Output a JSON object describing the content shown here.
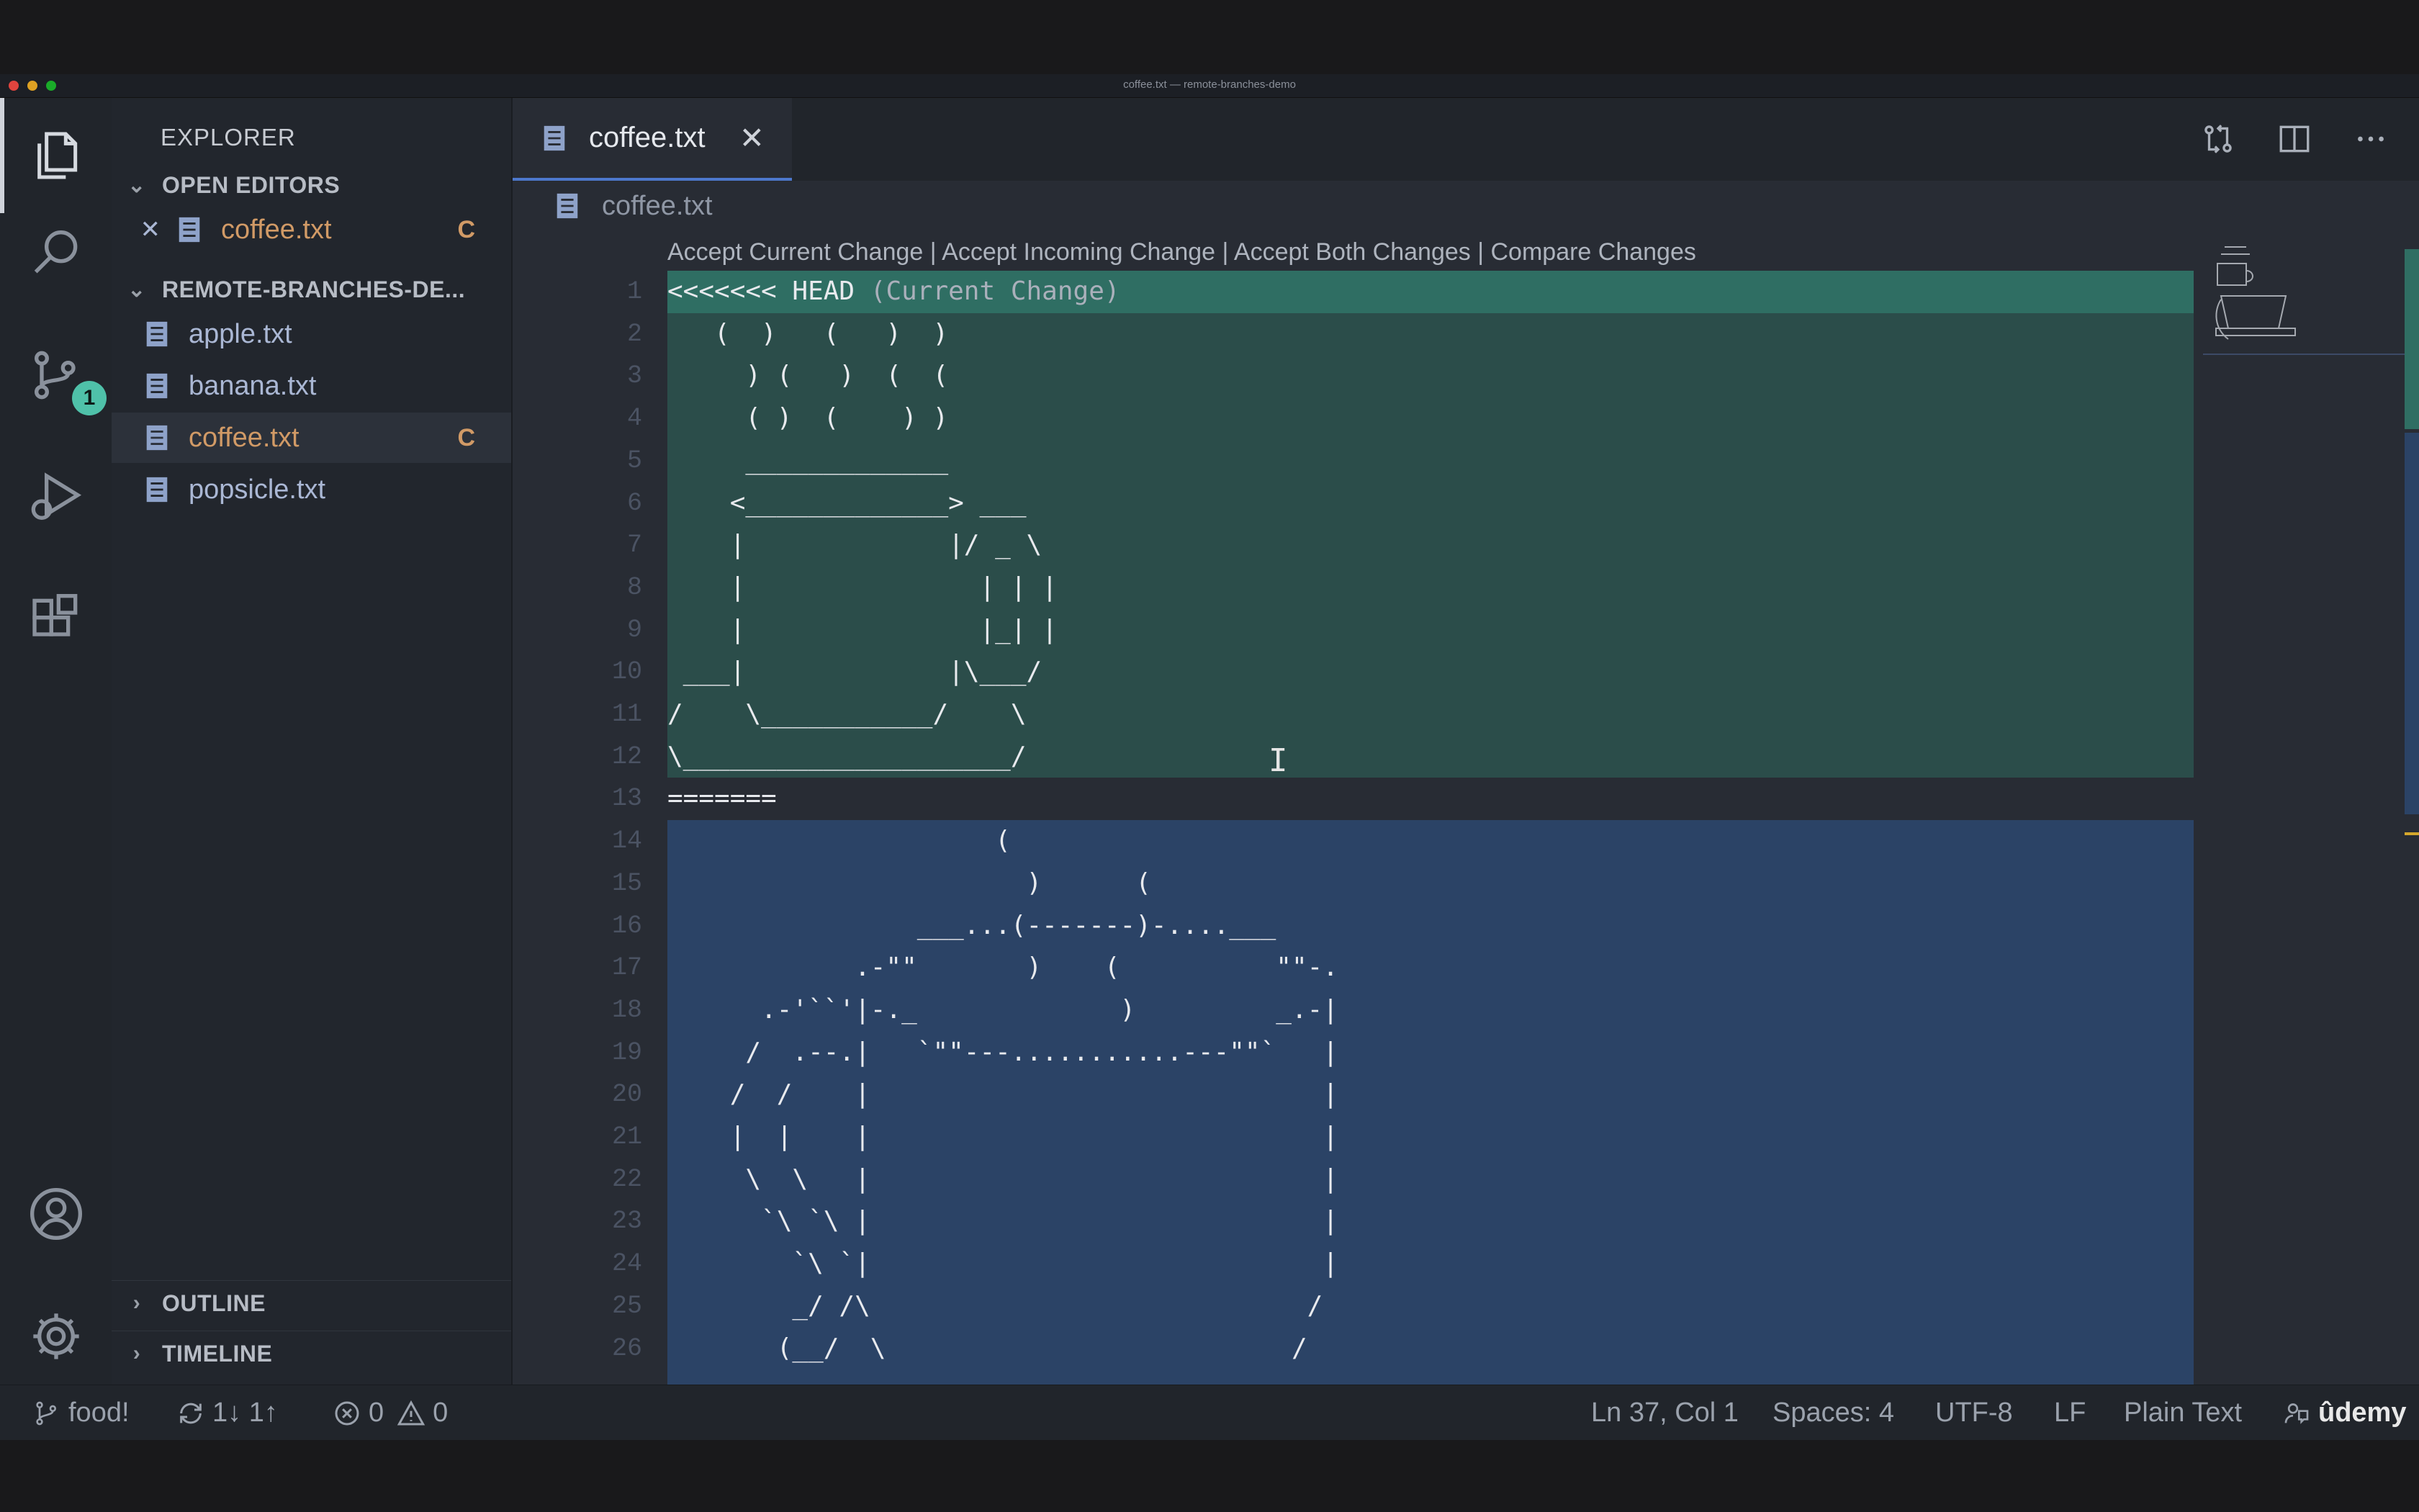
{
  "window": {
    "title": "coffee.txt — remote-branches-demo"
  },
  "activity_bar": {
    "items": [
      {
        "name": "explorer-icon",
        "active": true
      },
      {
        "name": "search-icon"
      },
      {
        "name": "source-control-icon",
        "badge": "1"
      },
      {
        "name": "run-debug-icon"
      },
      {
        "name": "extensions-icon"
      }
    ],
    "bottom": [
      {
        "name": "accounts-icon"
      },
      {
        "name": "settings-gear-icon"
      }
    ]
  },
  "sidebar": {
    "title": "EXPLORER",
    "open_editors": {
      "label": "OPEN EDITORS",
      "items": [
        {
          "close": "✕",
          "name": "coffee.txt",
          "status": "C"
        }
      ]
    },
    "folder": {
      "label": "REMOTE-BRANCHES-DE...",
      "files": [
        {
          "name": "apple.txt",
          "status": ""
        },
        {
          "name": "banana.txt",
          "status": ""
        },
        {
          "name": "coffee.txt",
          "status": "C"
        },
        {
          "name": "popsicle.txt",
          "status": ""
        }
      ]
    },
    "outline_label": "OUTLINE",
    "timeline_label": "TIMELINE"
  },
  "editor": {
    "tab": {
      "label": "coffee.txt",
      "close": "✕"
    },
    "breadcrumb": "coffee.txt",
    "codelens": "Accept Current Change | Accept Incoming Change | Accept Both Changes | Compare Changes",
    "head_marker": "<<<<<<< HEAD",
    "head_label": " (Current Change)",
    "lines": [
      "",
      "   (  )   (   )  )",
      "     ) (   )  (  (",
      "     ( )  (    ) )",
      "     _____________",
      "    <_____________> ___",
      "    |             |/ _ \\",
      "    |               | | |",
      "    |               |_| |",
      " ___|             |\\___/",
      "/    \\___________/    \\",
      "\\_____________________/",
      "=======",
      "                     (",
      "                       )      (",
      "                ___...(-------)-....___",
      "            .-\"\"       )    (          \"\"-.",
      "      .-'``'|-._             )         _.-|",
      "     /  .--.|   `\"\"---...........---\"\"`   |",
      "    /  /    |                             |",
      "    |  |    |                             |",
      "     \\  \\   |                             |",
      "      `\\ `\\ |                             |",
      "        `\\ `|                             |",
      "        _/ /\\                            /",
      "       (__/  \\                          /"
    ]
  },
  "status_bar": {
    "branch": "food!",
    "sync": "1↓ 1↑",
    "errors": "0",
    "warnings": "0",
    "position": "Ln 37, Col 1",
    "spaces": "Spaces: 4",
    "encoding": "UTF-8",
    "eol": "LF",
    "language": "Plain Text",
    "watermark": "ûdemy"
  },
  "colors": {
    "current_change_bg": "#2b4d4a",
    "current_header_bg": "#2f6e63",
    "incoming_change_bg": "#2b4366",
    "conflict_status": "#d19a66",
    "badge": "#4fc1a9"
  }
}
